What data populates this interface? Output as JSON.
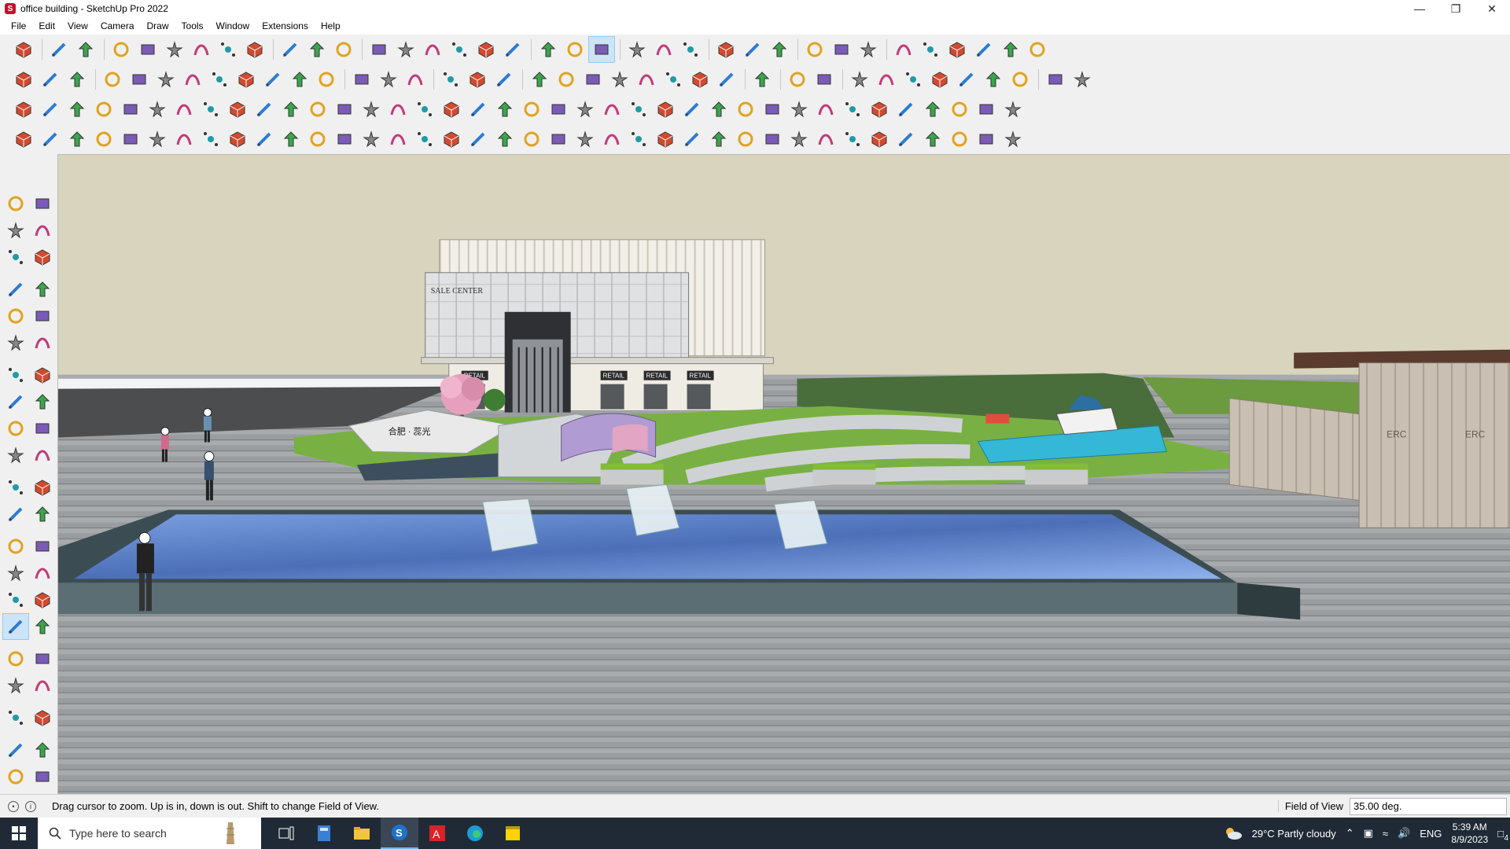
{
  "window": {
    "title": "office building - SketchUp Pro 2022",
    "controls": [
      "minimize-icon",
      "restore-icon",
      "close-icon"
    ]
  },
  "menu": [
    "File",
    "Edit",
    "View",
    "Camera",
    "Draw",
    "Tools",
    "Window",
    "Extensions",
    "Help"
  ],
  "scene": {
    "signs": {
      "sale_center": "SALE CENTER",
      "retail": "RETAIL",
      "plaza": "合肥 · 蕊光",
      "wall_left": "ERC",
      "wall_right": "ERC"
    },
    "colors": {
      "sky": "#d8d4bd",
      "pavement": "#8e9294",
      "water": "#5d7fc0",
      "grass": "#79b043",
      "building": "#e8e6e0"
    }
  },
  "status": {
    "message": "Drag cursor to zoom.  Up is in, down is out. Shift to change Field of View.",
    "vcb_label": "Field of View",
    "vcb_value": "35.00 deg."
  },
  "taskbar": {
    "search_placeholder": "Type here to search",
    "weather": "29°C  Partly cloudy",
    "language": "ENG",
    "time": "5:39 AM",
    "date": "8/9/2023",
    "notification_count": "4"
  }
}
